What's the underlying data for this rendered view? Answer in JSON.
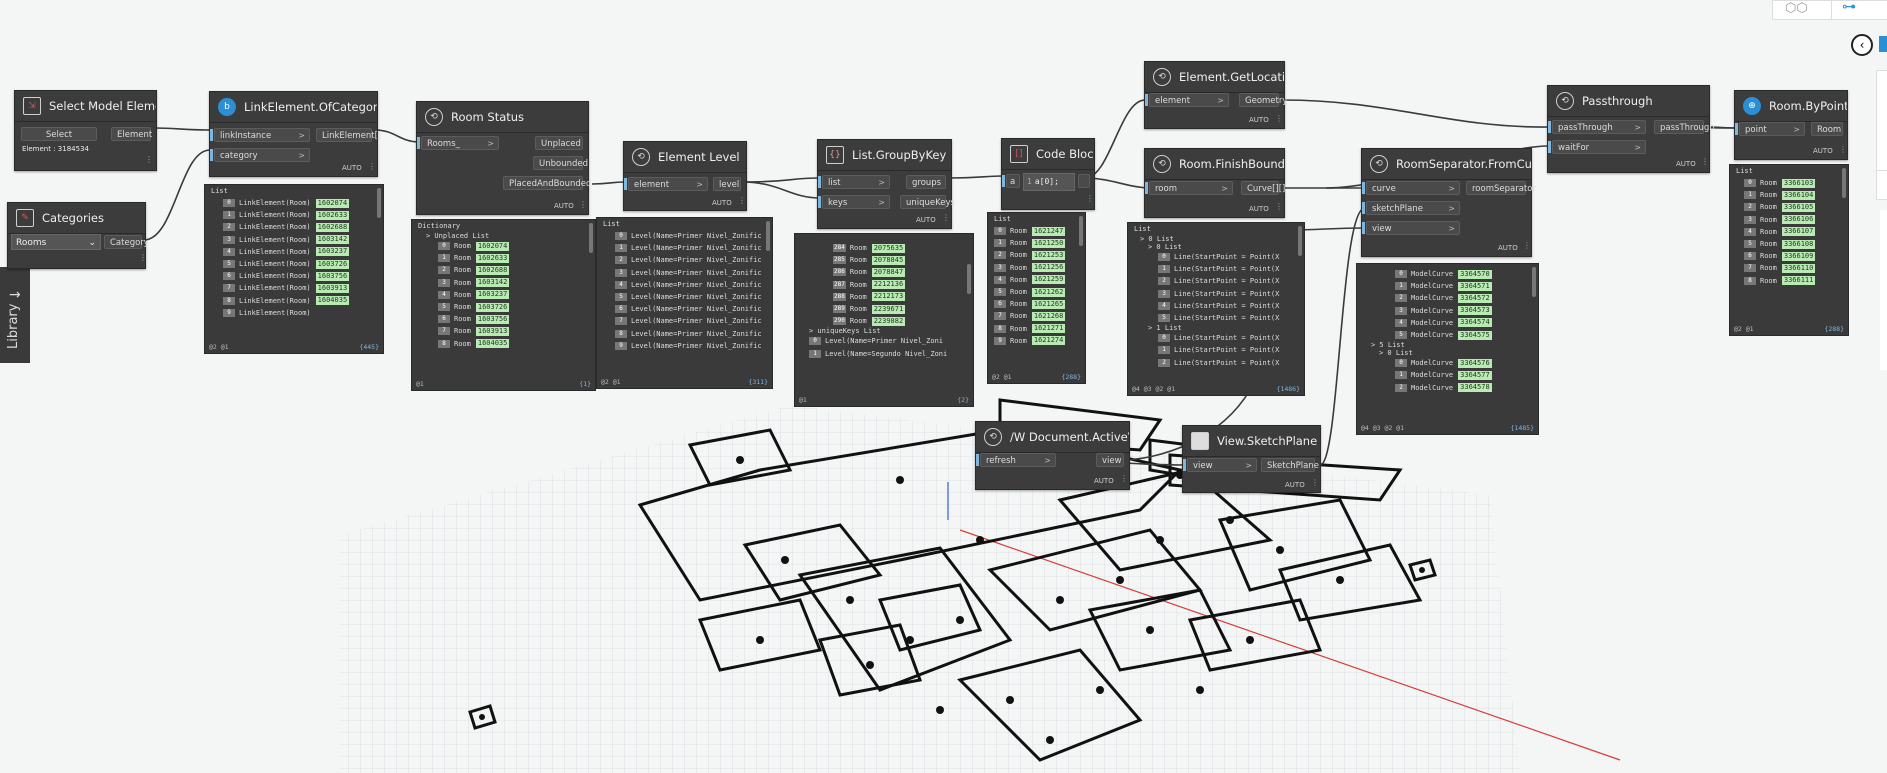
{
  "library_label": "Library",
  "nodes": {
    "select_model": {
      "title": "Select Model Element",
      "select_btn": "Select",
      "out": "Element",
      "element_text": "Element : 3184534"
    },
    "categories": {
      "title": "Categories",
      "selected": "Rooms",
      "out": "Category"
    },
    "link_of_category": {
      "title": "LinkElement.OfCategory",
      "in1": "linkInstance",
      "in2": "category",
      "out": "LinkElement[]",
      "auto": "AUTO"
    },
    "room_status": {
      "title": "Room Status",
      "in1": "Rooms_",
      "out1": "Unplaced",
      "out2": "Unbounded",
      "out3": "PlacedAndBounded",
      "auto": "AUTO"
    },
    "element_level": {
      "title": "Element Level",
      "in1": "element",
      "out": "level",
      "auto": "AUTO"
    },
    "group_by_key": {
      "title": "List.GroupByKey",
      "in1": "list",
      "in2": "keys",
      "out1": "groups",
      "out2": "uniqueKeys",
      "auto": "AUTO"
    },
    "code_block": {
      "title": "Code Block",
      "in1": "a",
      "code": "a[0];",
      "line": "1"
    },
    "get_location": {
      "title": "Element.GetLocation",
      "in1": "element",
      "out": "Geometry",
      "auto": "AUTO"
    },
    "finish_boundary": {
      "title": "Room.FinishBoundary",
      "in1": "room",
      "out": "Curve[][]",
      "auto": "AUTO"
    },
    "passthrough": {
      "title": "Passthrough",
      "in1": "passThrough",
      "in2": "waitFor",
      "out": "passThrough",
      "auto": "AUTO"
    },
    "room_by_point": {
      "title": "Room.ByPoint",
      "in1": "point",
      "out": "Room",
      "auto": "AUTO"
    },
    "room_separator": {
      "title": "RoomSeparator.FromCurve",
      "in1": "curve",
      "in2": "sketchPlane",
      "in3": "view",
      "out": "roomSeparator",
      "auto": "AUTO"
    },
    "active_view": {
      "title": "/W Document.ActiveView",
      "in1": "refresh",
      "out": "view",
      "auto": "AUTO"
    },
    "sketch_plane": {
      "title": "View.SketchPlane",
      "in1": "view",
      "out": "SketchPlane",
      "auto": "AUTO"
    }
  },
  "previews": {
    "link": {
      "header": "List",
      "rows": [
        [
          "0",
          "LinkElement(Room)",
          "1602074"
        ],
        [
          "1",
          "LinkElement(Room)",
          "1602633"
        ],
        [
          "2",
          "LinkElement(Room)",
          "1602688"
        ],
        [
          "3",
          "LinkElement(Room)",
          "1603142"
        ],
        [
          "4",
          "LinkElement(Room)",
          "1603237"
        ],
        [
          "5",
          "LinkElement(Room)",
          "1603726"
        ],
        [
          "6",
          "LinkElement(Room)",
          "1603756"
        ],
        [
          "7",
          "LinkElement(Room)",
          "1603913"
        ],
        [
          "8",
          "LinkElement(Room)",
          "1604035"
        ],
        [
          "9",
          "LinkElement(Room)",
          ""
        ]
      ],
      "foot_left": "@2 @1",
      "foot_right": "{445}"
    },
    "status": {
      "header": "Dictionary",
      "sub": "> Unplaced List",
      "rows": [
        [
          "0",
          "Room",
          "1602074"
        ],
        [
          "1",
          "Room",
          "1602633"
        ],
        [
          "2",
          "Room",
          "1602688"
        ],
        [
          "3",
          "Room",
          "1603142"
        ],
        [
          "4",
          "Room",
          "1603237"
        ],
        [
          "5",
          "Room",
          "1603726"
        ],
        [
          "6",
          "Room",
          "1603756"
        ],
        [
          "7",
          "Room",
          "1603913"
        ],
        [
          "8",
          "Room",
          "1604035"
        ]
      ],
      "foot_left": "@1",
      "foot_right": "{1}"
    },
    "level": {
      "header": "List",
      "rows": [
        [
          "0",
          "Level(Name=Primer Nivel_Zonific"
        ],
        [
          "1",
          "Level(Name=Primer Nivel_Zonific"
        ],
        [
          "2",
          "Level(Name=Primer Nivel_Zonific"
        ],
        [
          "3",
          "Level(Name=Primer Nivel_Zonific"
        ],
        [
          "4",
          "Level(Name=Primer Nivel_Zonific"
        ],
        [
          "5",
          "Level(Name=Primer Nivel_Zonific"
        ],
        [
          "6",
          "Level(Name=Primer Nivel_Zonific"
        ],
        [
          "7",
          "Level(Name=Primer Nivel_Zonific"
        ],
        [
          "8",
          "Level(Name=Primer Nivel_Zonific"
        ],
        [
          "9",
          "Level(Name=Primer Nivel_Zonific"
        ]
      ],
      "foot_left": "@2 @1",
      "foot_right": "{311}"
    },
    "group": {
      "rows": [
        [
          "284",
          "Room",
          "2075635"
        ],
        [
          "285",
          "Room",
          "2078845"
        ],
        [
          "286",
          "Room",
          "2078847"
        ],
        [
          "287",
          "Room",
          "2212136"
        ],
        [
          "288",
          "Room",
          "2212173"
        ],
        [
          "289",
          "Room",
          "2239671"
        ],
        [
          "290",
          "Room",
          "2239882"
        ]
      ],
      "sub": "> uniqueKeys List",
      "keys": [
        [
          "0",
          "Level(Name=Primer Nivel_Zoni"
        ],
        [
          "1",
          "Level(Name=Segundo Nivel_Zoni"
        ]
      ],
      "foot_left": "@1",
      "foot_right": "{2}"
    },
    "code": {
      "header": "List",
      "rows": [
        [
          "0",
          "Room",
          "1621247"
        ],
        [
          "1",
          "Room",
          "1621250"
        ],
        [
          "2",
          "Room",
          "1621253"
        ],
        [
          "3",
          "Room",
          "1621256"
        ],
        [
          "4",
          "Room",
          "1621259"
        ],
        [
          "5",
          "Room",
          "1621262"
        ],
        [
          "6",
          "Room",
          "1621265"
        ],
        [
          "7",
          "Room",
          "1621268"
        ],
        [
          "8",
          "Room",
          "1621271"
        ],
        [
          "9",
          "Room",
          "1621274"
        ]
      ],
      "foot_left": "@2 @1",
      "foot_right": "{288}"
    },
    "boundary": {
      "header": "List",
      "sub1": "> 0 List",
      "sub2": "> 0 List",
      "rows": [
        [
          "0",
          "Line(StartPoint = Point(X"
        ],
        [
          "1",
          "Line(StartPoint = Point(X"
        ],
        [
          "2",
          "Line(StartPoint = Point(X"
        ],
        [
          "3",
          "Line(StartPoint = Point(X"
        ],
        [
          "4",
          "Line(StartPoint = Point(X"
        ],
        [
          "5",
          "Line(StartPoint = Point(X"
        ]
      ],
      "sub3": "> 1 List",
      "rows2": [
        [
          "0",
          "Line(StartPoint = Point(X"
        ],
        [
          "1",
          "Line(StartPoint = Point(X"
        ],
        [
          "2",
          "Line(StartPoint = Point(X"
        ]
      ],
      "foot_left": "@4 @3 @2 @1",
      "foot_right": "{1486}"
    },
    "separator": {
      "rows": [
        [
          "0",
          "ModelCurve",
          "3364570"
        ],
        [
          "1",
          "ModelCurve",
          "3364571"
        ],
        [
          "2",
          "ModelCurve",
          "3364572"
        ],
        [
          "3",
          "ModelCurve",
          "3364573"
        ],
        [
          "4",
          "ModelCurve",
          "3364574"
        ],
        [
          "5",
          "ModelCurve",
          "3364575"
        ]
      ],
      "sub1": "> 5 List",
      "sub2": "> 0 List",
      "rows2": [
        [
          "0",
          "ModelCurve",
          "3364576"
        ],
        [
          "1",
          "ModelCurve",
          "3364577"
        ],
        [
          "2",
          "ModelCurve",
          "3364578"
        ]
      ],
      "foot_left": "@4 @3 @2 @1",
      "foot_right": "{1485}"
    },
    "bypoint": {
      "header": "List",
      "rows": [
        [
          "0",
          "Room",
          "3366103"
        ],
        [
          "1",
          "Room",
          "3366104"
        ],
        [
          "2",
          "Room",
          "3366105"
        ],
        [
          "3",
          "Room",
          "3366106"
        ],
        [
          "4",
          "Room",
          "3366107"
        ],
        [
          "5",
          "Room",
          "3366108"
        ],
        [
          "6",
          "Room",
          "3366109"
        ],
        [
          "7",
          "Room",
          "3366110"
        ],
        [
          "8",
          "Room",
          "3366111"
        ]
      ],
      "foot_left": "@2 @1",
      "foot_right": "{288}"
    }
  },
  "colors": {
    "background": "#f4f5f5",
    "node": "#3c3c3c",
    "value_highlight": "#b9eab3",
    "wire": "#3a3a3a",
    "port_accent": "#7fb6de"
  }
}
